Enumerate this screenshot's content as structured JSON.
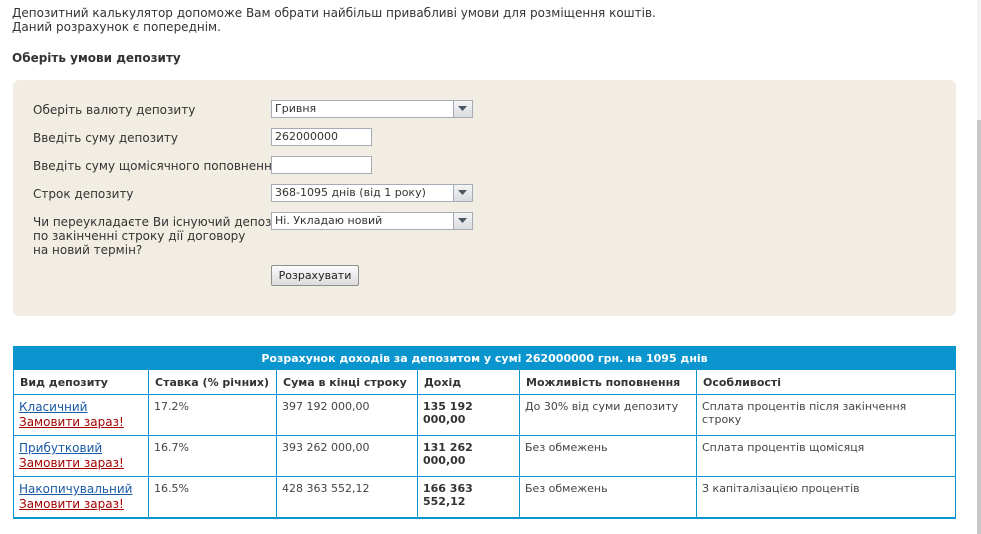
{
  "intro": {
    "line1": "Депозитний калькулятор допоможе Вам обрати найбільш привабливі умови для розміщення коштів.",
    "line2": "Даний розрахунок є попереднім."
  },
  "section_title": "Оберіть умови депозиту",
  "form": {
    "currency_label": "Оберіть валюту депозиту",
    "currency_value": "Гривня",
    "amount_label": "Введіть суму депозиту",
    "amount_value": "262000000",
    "monthly_label": "Введіть суму щомісячного поповнення",
    "monthly_value": "",
    "term_label": "Строк депозиту",
    "term_value": "368-1095 днів (від 1 року)",
    "reissue_label_1": "Чи переукладаєте Ви існуючий депозит",
    "reissue_label_2": "по закінченні строку дії договору",
    "reissue_label_3": "на новий термін?",
    "reissue_value": "Ні. Укладаю новий",
    "calculate_button": "Розрахувати"
  },
  "results": {
    "title": "Розрахунок доходів за депозитом у сумі 262000000 грн. на 1095 днів",
    "headers": [
      "Вид депозиту",
      "Ставка (% річних)",
      "Сума в кінці строку",
      "Дохід",
      "Можливість поповнення",
      "Особливості"
    ],
    "rows": [
      {
        "name": "Класичний",
        "order": "Замовити зараз!",
        "rate": "17.2%",
        "total": "397 192 000,00",
        "income": "135 192 000,00",
        "topup": "До 30% від суми депозиту",
        "features": "Сплата процентів після закінчення строку"
      },
      {
        "name": "Прибутковий",
        "order": "Замовити зараз!",
        "rate": "16.7%",
        "total": "393 262 000,00",
        "income": "131 262 000,00",
        "topup": "Без обмежень",
        "features": "Сплата процентів щомісяця"
      },
      {
        "name": "Накопичувальний",
        "order": "Замовити зараз!",
        "rate": "16.5%",
        "total": "428 363 552,12",
        "income": "166 363 552,12",
        "topup": "Без обмежень",
        "features": "З капіталізацією процентів"
      }
    ]
  },
  "colors": {
    "accent": "#0a95cf",
    "panel_bg": "#f1ede3",
    "link": "#1a5aa6",
    "order_link": "#a40000"
  }
}
